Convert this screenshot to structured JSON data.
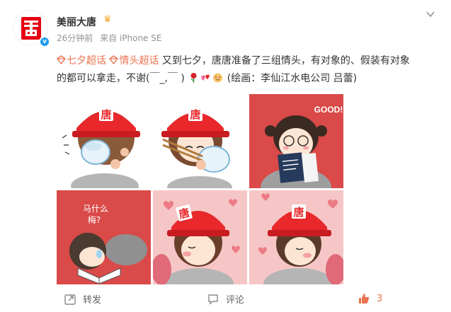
{
  "author": {
    "name": "美丽大唐",
    "avatar_icon": "tang-logo-avatar",
    "verified_icon": "verified-badge-icon",
    "vip_icon": "crown-icon"
  },
  "meta": {
    "time": "26分钟前",
    "source": "来自 iPhone SE"
  },
  "post": {
    "tag1": "七夕超话",
    "tag2": "情头超话",
    "line1_text": "又到七夕，唐唐准备了三组情头，有对象的、假装有对象",
    "line2_text": "的都可以拿走，不谢(￣_,￣ )",
    "credit": "(绘画：李仙江水电公司 吕蕾)"
  },
  "images": {
    "speech_good": "GOOD!",
    "speech_line1": "马什么",
    "speech_line2": "梅?",
    "hat_char": "唐"
  },
  "footer": {
    "repost": "转发",
    "comment": "评论",
    "likes": "3"
  },
  "colors": {
    "accent": "#eb7350",
    "hat_red": "#e8282b",
    "link_orange": "#eb7350"
  }
}
